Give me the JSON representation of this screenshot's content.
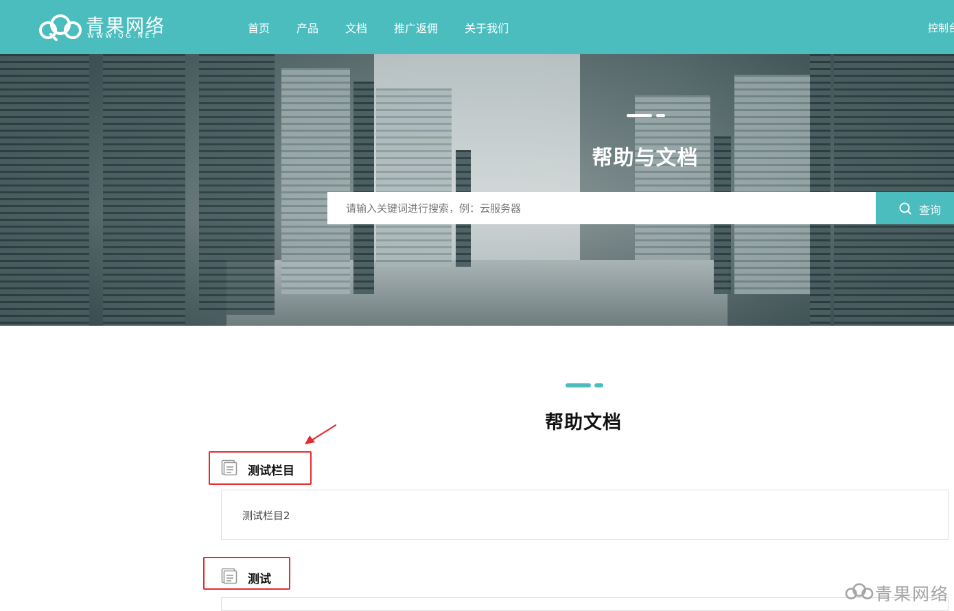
{
  "brand": {
    "name": "青果网络",
    "domain": "WWW.QG.NET"
  },
  "nav": {
    "items": [
      {
        "label": "首页"
      },
      {
        "label": "产品"
      },
      {
        "label": "文档"
      },
      {
        "label": "推广返佣"
      },
      {
        "label": "关于我们"
      }
    ],
    "console_label": "控制台"
  },
  "banner": {
    "title": "帮助与文档",
    "search_placeholder": "请输入关键词进行搜索，例：云服务器",
    "search_button": "查询"
  },
  "section": {
    "title": "帮助文档"
  },
  "categories": [
    {
      "title": "测试栏目",
      "items": [
        {
          "label": "测试栏目2"
        }
      ]
    },
    {
      "title": "测试",
      "items": []
    }
  ],
  "watermark": {
    "text": "青果网络"
  },
  "colors": {
    "brand": "#4bbdbf",
    "highlight": "#e7292c"
  }
}
